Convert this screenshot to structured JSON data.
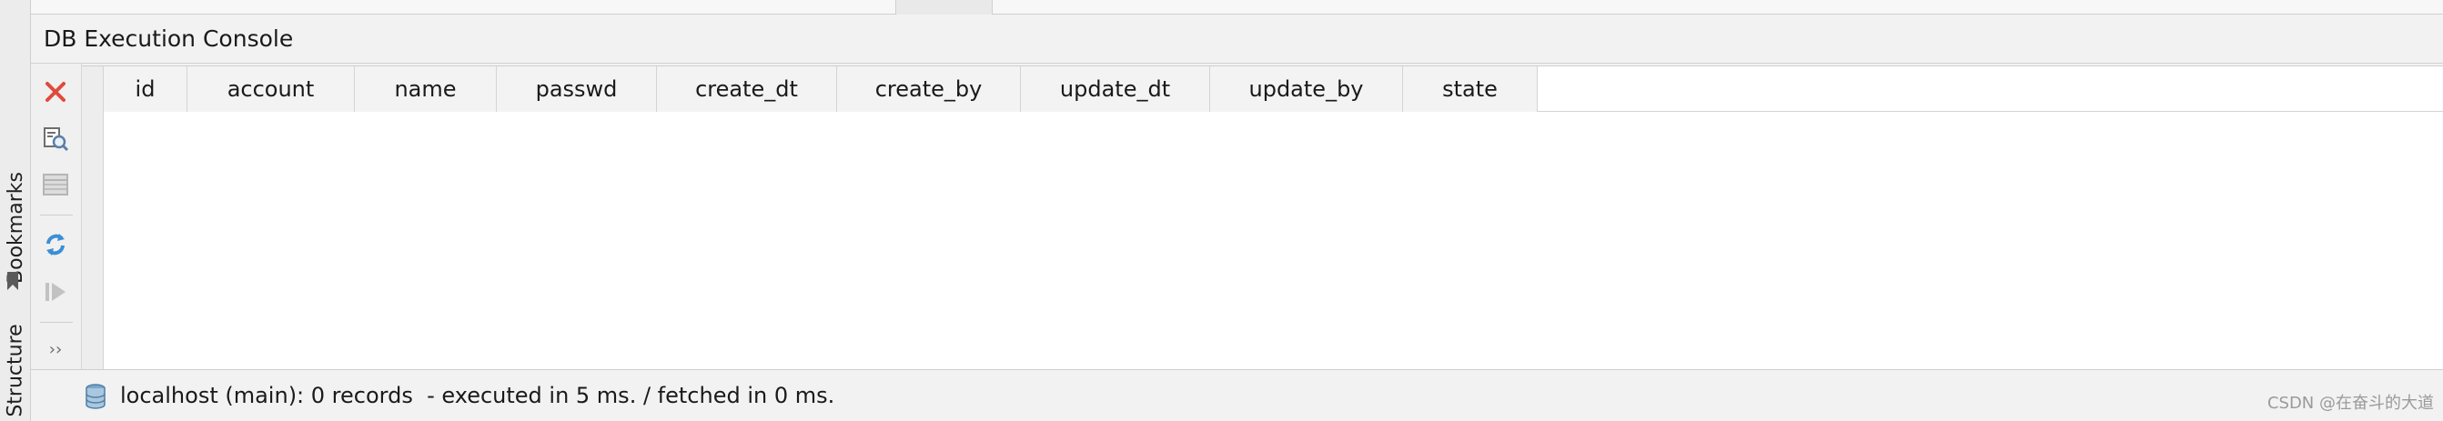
{
  "left_strip": {
    "bookmarks_label": "Bookmarks",
    "structure_label": "Structure"
  },
  "console": {
    "title": "DB Execution Console"
  },
  "toolbar": {
    "buttons": [
      {
        "icon": "close-icon",
        "color": "#e04a3c"
      },
      {
        "icon": "find-in-file-icon",
        "color": "#6e6e6e"
      },
      {
        "icon": "table-icon",
        "color": "#b5b5b5"
      },
      {
        "icon": "refresh-icon",
        "color": "#3a8fd6"
      },
      {
        "icon": "run-icon",
        "color": "#b5b5b5"
      }
    ],
    "more_label": "››"
  },
  "table": {
    "columns": [
      "id",
      "account",
      "name",
      "passwd",
      "create_dt",
      "create_by",
      "update_dt",
      "update_by",
      "state"
    ],
    "rows": []
  },
  "status": {
    "text": "localhost (main): 0 records  - executed in 5 ms. / fetched in 0 ms."
  },
  "watermark": "CSDN @在奋斗的大道"
}
